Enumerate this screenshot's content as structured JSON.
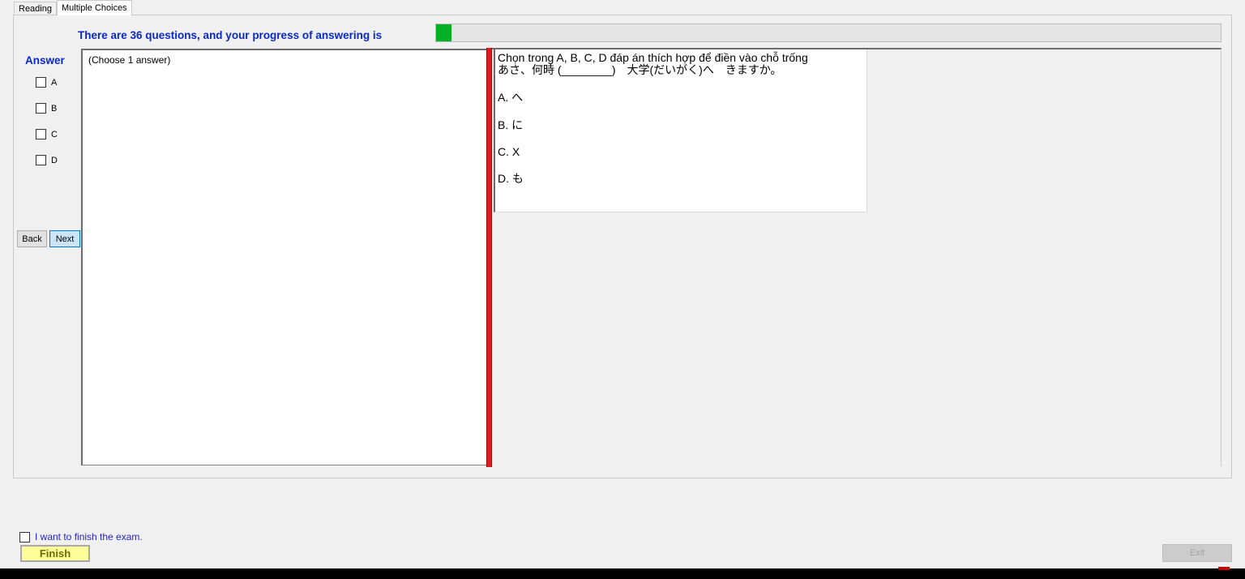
{
  "tabs": [
    "Reading",
    "Multiple Choices"
  ],
  "progress": {
    "label": "There are 36 questions, and your progress of answering is",
    "fraction": 0.02
  },
  "answer_panel": {
    "title": "Answer",
    "options": [
      "A",
      "B",
      "C",
      "D"
    ]
  },
  "nav": {
    "back_label": "Back",
    "next_label": "Next"
  },
  "answer_box": {
    "hint": "(Choose 1 answer)"
  },
  "question": {
    "instruction": "Chọn trong A, B, C, D đáp án thích hợp để điền vào chỗ trống",
    "sentence": "あさ、何時 (________)　大学(だいがく)へ　きますか。",
    "choices": [
      "A.  へ",
      "B.  に",
      "C.  X",
      "D.  も"
    ]
  },
  "finish": {
    "checkbox_label": "I want to finish the exam.",
    "button_label": "Finish"
  },
  "exit": {
    "label": "Exit"
  },
  "colors": {
    "accent_blue": "#0a2ac8",
    "progress_green": "#06b025",
    "splitter_red": "#e01d1d",
    "finish_yellow": "#ffff99"
  }
}
